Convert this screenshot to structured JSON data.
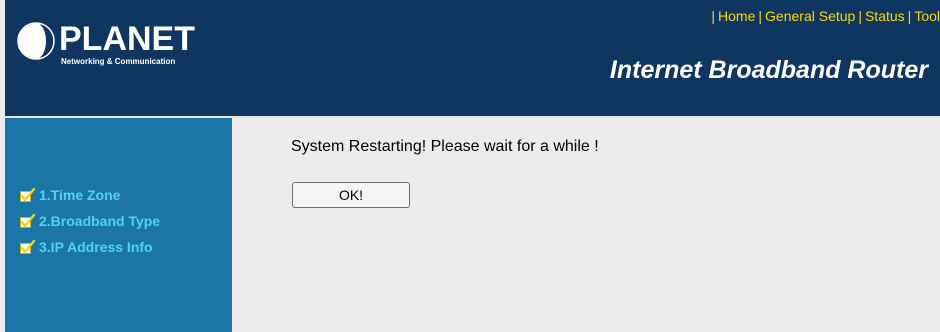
{
  "header": {
    "logo": {
      "wordmark": "PLANET",
      "tagline": "Networking & Communication"
    },
    "nav": [
      {
        "label": "Home"
      },
      {
        "label": "General Setup"
      },
      {
        "label": "Status"
      },
      {
        "label": "Tool"
      }
    ],
    "product_title": "Internet Broadband Router",
    "colors": {
      "header_bg": "#0f3561",
      "nav_link": "#ffd800"
    }
  },
  "sidebar": {
    "items": [
      {
        "label": "1.Time Zone",
        "icon": "checkmark-icon"
      },
      {
        "label": "2.Broadband Type",
        "icon": "checkmark-icon"
      },
      {
        "label": "3.IP Address Info",
        "icon": "checkmark-icon"
      }
    ],
    "colors": {
      "bg": "#1b76a7",
      "label": "#4fd3f2"
    }
  },
  "main": {
    "message": "System Restarting! Please wait for a while !",
    "ok_label": "OK!"
  }
}
